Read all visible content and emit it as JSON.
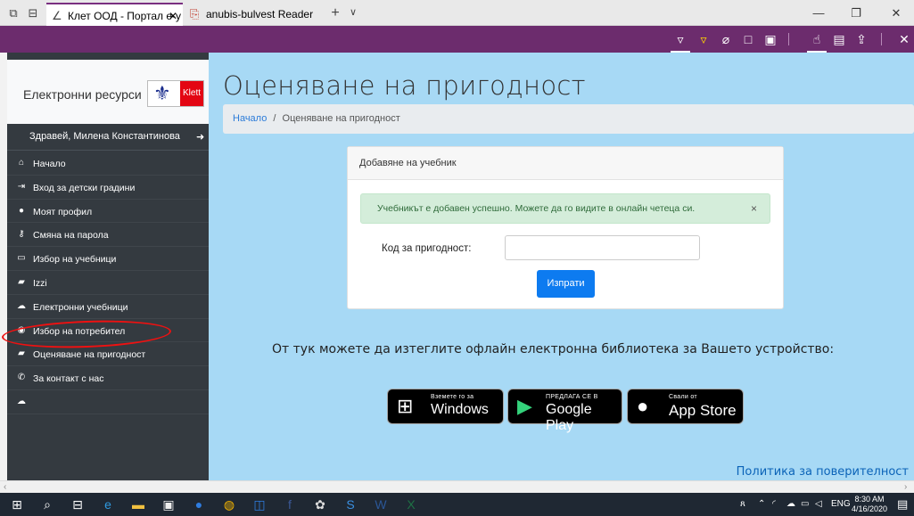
{
  "browser": {
    "tabs": [
      {
        "title": "Клет ООД - Портал е-у",
        "active": true
      },
      {
        "title": "anubis-bulvest Reader",
        "active": false
      }
    ],
    "new_tab": "+",
    "tab_list": "∨"
  },
  "sidebar": {
    "brand_text": "Електронни ресурси",
    "logo_text": "Klett",
    "greeting": "Здравей, Милена Константинова",
    "items": [
      {
        "label": "Начало",
        "icon": "home-icon"
      },
      {
        "label": "Вход за детски градини",
        "icon": "sign-in-icon"
      },
      {
        "label": "Моят профил",
        "icon": "user-icon"
      },
      {
        "label": "Смяна на парола",
        "icon": "key-icon"
      },
      {
        "label": "Избор на учебници",
        "icon": "tablet-icon"
      },
      {
        "label": "Izzi",
        "icon": "book-icon"
      },
      {
        "label": "Електронни учебници",
        "icon": "cloud-icon"
      },
      {
        "label": "Избор на потребител",
        "icon": "user-select-icon"
      },
      {
        "label": "Оценяване на пригодност",
        "icon": "book-icon"
      },
      {
        "label": "За контакт с нас",
        "icon": "phone-icon"
      },
      {
        "label": "",
        "icon": "cloud-icon"
      }
    ]
  },
  "main": {
    "title": "Оценяване на пригодност",
    "breadcrumb": {
      "home": "Начало",
      "separator": "/",
      "current": "Оценяване на пригодност"
    },
    "card": {
      "header": "Добавяне на учебник",
      "alert": "Учебникът е добавен успешно. Можете да го видите в онлайн четеца си.",
      "alert_close": "×",
      "field_label": "Код за пригодност:",
      "field_value": "",
      "submit": "Изпрати"
    },
    "download_text": "От тук можете да изтеглите офлайн електронна библиотека за Вашето устройство:",
    "stores": [
      {
        "small": "Вземете го за",
        "big": "Windows"
      },
      {
        "small": "ПРЕДЛАГА СЕ В",
        "big": "Google Play"
      },
      {
        "small": "Свали от",
        "big": "App Store"
      }
    ],
    "privacy": "Политика за поверителност"
  },
  "taskbar": {
    "lang": "ENG",
    "time": "8:30 AM",
    "date": "4/16/2020"
  },
  "colors": {
    "toolbar": "#6c2c6d",
    "sidebar": "#343a40",
    "main_bg": "#a7d9f5",
    "accent": "#0d7bf0",
    "highlight": "#e11"
  }
}
